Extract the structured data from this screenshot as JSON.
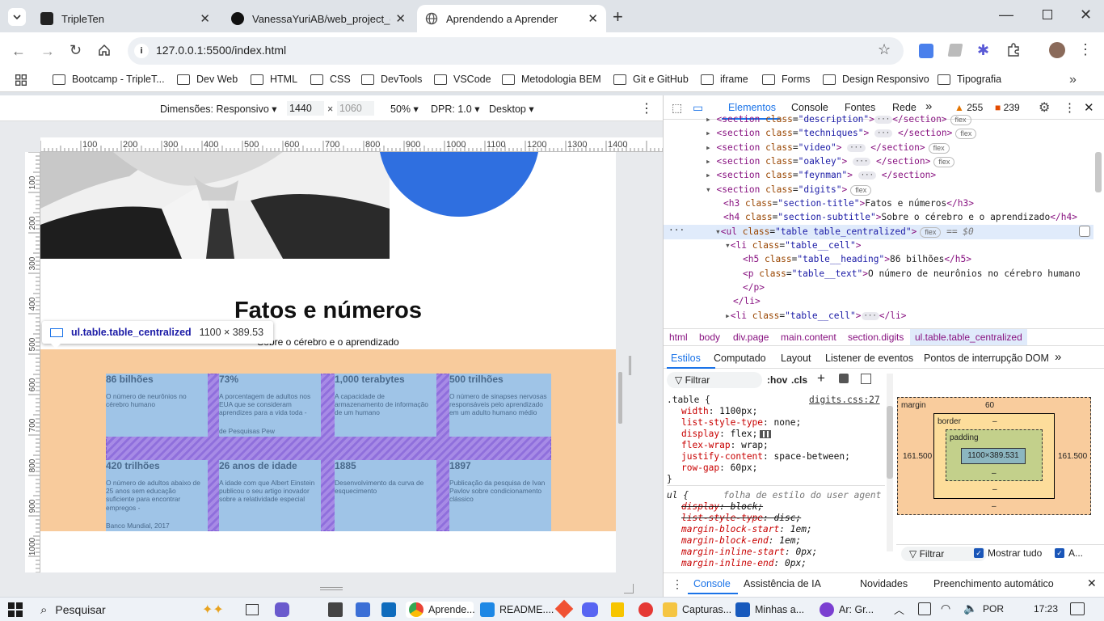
{
  "browser": {
    "tabs": [
      {
        "title": "TripleTen"
      },
      {
        "title": "VanessaYuriAB/web_project_co"
      },
      {
        "title": "Aprendendo a Aprender"
      }
    ],
    "url": "127.0.0.1:5500/index.html",
    "bookmarks": [
      "Bootcamp - TripleT...",
      "Dev Web",
      "HTML",
      "CSS",
      "DevTools",
      "VSCode",
      "Metodologia BEM",
      "Git e GitHub",
      "iframe",
      "Forms",
      "Design Responsivo",
      "Tipografia"
    ]
  },
  "device_toolbar": {
    "dimensions_label": "Dimensões: Responsivo",
    "width": "1440",
    "times": "×",
    "height": "1060",
    "zoom": "50%",
    "dpr": "DPR: 1.0",
    "mode": "Desktop"
  },
  "ruler": {
    "top_ticks": [
      "100",
      "200",
      "300",
      "400",
      "500",
      "600",
      "700",
      "800",
      "900",
      "1000",
      "1100",
      "1200",
      "1300",
      "1400"
    ],
    "left_ticks": [
      "100",
      "200",
      "300",
      "400",
      "500",
      "600",
      "700",
      "800",
      "900",
      "1000"
    ]
  },
  "page": {
    "section_title": "Fatos e números",
    "section_subtitle": "Sobre o cérebro e o aprendizado",
    "tooltip_selector": "ul.table.table_centralized",
    "tooltip_size": "1100 × 389.53",
    "cells": [
      {
        "heading": "86 bilhões",
        "text": "O número de neurônios no cérebro humano",
        "source": ""
      },
      {
        "heading": "73%",
        "text": "A porcentagem de adultos nos EUA que se consideram aprendizes para a vida toda -",
        "source": "de Pesquisas Pew"
      },
      {
        "heading": "1,000 terabytes",
        "text": "A capacidade de armazenamento de informação de um humano",
        "source": ""
      },
      {
        "heading": "500 trilhões",
        "text": "O número de sinapses nervosas responsáveis pelo aprendizado em um adulto humano médio",
        "source": ""
      },
      {
        "heading": "420 trilhões",
        "text": "O número de adultos abaixo de 25 anos sem educação suficiente para encontrar empregos -",
        "source": "Banco Mundial, 2017"
      },
      {
        "heading": "26 anos de idade",
        "text": "A idade com que Albert Einstein publicou o seu artigo inovador sobre a relatividade especial",
        "source": ""
      },
      {
        "heading": "1885",
        "text": "Desenvolvimento da curva de esquecimento",
        "source": ""
      },
      {
        "heading": "1897",
        "text": "Publicação da pesquisa de Ivan Pavlov sobre condicionamento clássico",
        "source": ""
      }
    ]
  },
  "devtools": {
    "tabs": [
      "Elementos",
      "Console",
      "Fontes",
      "Rede"
    ],
    "warnings": "255",
    "errors": "239",
    "dom_lines": [
      {
        "indent": 0,
        "html": "section_desc"
      },
      {
        "indent": 0,
        "html": "section_techniques"
      }
    ],
    "dom": {
      "l1_class": "description",
      "l2_class": "techniques",
      "l3_class": "video",
      "l4_class": "oakley",
      "l5_class": "feynman",
      "l6_class": "digits",
      "h3_class": "section-title",
      "h3_text": "Fatos e números",
      "h4_class": "section-subtitle",
      "h4_text": "Sobre o cérebro e o aprendizado",
      "ul_class": "table table_centralized",
      "ul_eq": "== $0",
      "li_class": "table__cell",
      "h5_class": "table__heading",
      "h5_text": "86 bilhões",
      "p_class": "table__text",
      "p_text": "O número de neurônios no cérebro humano",
      "flex": "flex"
    },
    "breadcrumbs": [
      "html",
      "body",
      "div.page",
      "main.content",
      "section.digits",
      "ul.table.table_centralized"
    ],
    "style_tabs": [
      "Estilos",
      "Computado",
      "Layout",
      "Listener de eventos",
      "Pontos de interrupção DOM"
    ],
    "filter_placeholder": "Filtrar",
    "hov": ":hov",
    "cls": ".cls",
    "rule1": {
      "selector": ".table {",
      "source": "digits.css:27",
      "props": [
        {
          "name": "width",
          "value": "1100px;"
        },
        {
          "name": "list-style-type",
          "value": "none;"
        },
        {
          "name": "display",
          "value": "flex;"
        },
        {
          "name": "flex-wrap",
          "value": "wrap;"
        },
        {
          "name": "justify-content",
          "value": "space-between;"
        },
        {
          "name": "row-gap",
          "value": "60px;"
        }
      ],
      "close": "}"
    },
    "rule2": {
      "selector": "ul {",
      "source": "folha de estilo do user agent",
      "props": [
        {
          "name": "display",
          "value": "block;",
          "struck": true
        },
        {
          "name": "list-style-type",
          "value": "disc;",
          "struck": true
        },
        {
          "name": "margin-block-start",
          "value": "1em;"
        },
        {
          "name": "margin-block-end",
          "value": "1em;"
        },
        {
          "name": "margin-inline-start",
          "value": "0px;"
        },
        {
          "name": "margin-inline-end",
          "value": "0px;"
        }
      ]
    },
    "box_model": {
      "margin_label": "margin",
      "margin_top": "60",
      "margin_side": "161.500",
      "margin_dash": "–",
      "border_label": "border",
      "padding_label": "padding",
      "content": "1100×389.531"
    },
    "computed_filter": "Filtrar",
    "show_all": "Mostrar tudo",
    "show_all_short": "A...",
    "drawer_tabs": [
      "Console",
      "Assistência de IA",
      "Novidades",
      "Preenchimento automático"
    ]
  },
  "taskbar": {
    "search": "Pesquisar",
    "apps": [
      "Aprende...",
      "README....",
      "Capturas...",
      "Minhas a...",
      "Ar: Gr..."
    ],
    "lang": "POR",
    "time": "17:23"
  },
  "colors": {
    "accent": "#1a73e8",
    "section_bg": "#f8cb9c",
    "cell_bg": "#9fc4e7",
    "gap": "#9b7fe0"
  }
}
